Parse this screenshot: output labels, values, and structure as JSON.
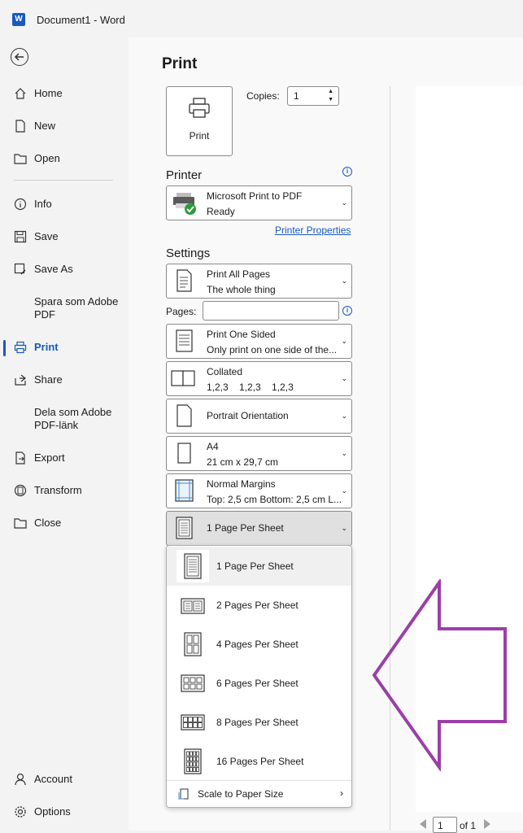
{
  "titlebar": {
    "title": "Document1  -  Word",
    "app_icon": "W"
  },
  "sidebar": {
    "items": [
      {
        "label": "Home",
        "icon": "home-icon"
      },
      {
        "label": "New",
        "icon": "new-doc-icon"
      },
      {
        "label": "Open",
        "icon": "folder-icon"
      },
      {
        "label": "Info",
        "icon": "info-icon"
      },
      {
        "label": "Save",
        "icon": "save-icon"
      },
      {
        "label": "Save As",
        "icon": "save-as-icon"
      },
      {
        "label": "Spara som Adobe PDF",
        "icon": ""
      },
      {
        "label": "Print",
        "icon": "printer-icon"
      },
      {
        "label": "Share",
        "icon": "share-icon"
      },
      {
        "label": "Dela som Adobe PDF-länk",
        "icon": ""
      },
      {
        "label": "Export",
        "icon": "export-icon"
      },
      {
        "label": "Transform",
        "icon": "transform-icon"
      },
      {
        "label": "Close",
        "icon": "close-folder-icon"
      },
      {
        "label": "Account",
        "icon": "account-icon"
      },
      {
        "label": "Options",
        "icon": "options-gear-icon"
      }
    ],
    "active": "Print"
  },
  "print": {
    "heading": "Print",
    "print_button": "Print",
    "copies_label": "Copies:",
    "copies_value": "1",
    "printer_heading": "Printer",
    "printer_name": "Microsoft Print to PDF",
    "printer_status": "Ready",
    "printer_properties": "Printer Properties",
    "settings_heading": "Settings",
    "pages_label": "Pages:",
    "pages_value": "",
    "settings": [
      {
        "line1": "Print All Pages",
        "line2": "The whole thing"
      },
      {
        "line1": "Print One Sided",
        "line2": "Only print on one side of the..."
      },
      {
        "line1": "Collated",
        "line2": "1,2,3    1,2,3    1,2,3"
      },
      {
        "line1": "Portrait Orientation",
        "line2": ""
      },
      {
        "line1": "A4",
        "line2": "21 cm x 29,7 cm"
      },
      {
        "line1": "Normal Margins",
        "line2": "Top: 2,5 cm Bottom: 2,5 cm L..."
      },
      {
        "line1": "1 Page Per Sheet",
        "line2": ""
      }
    ],
    "pages_per_sheet_menu": [
      "1 Page Per Sheet",
      "2 Pages Per Sheet",
      "4 Pages Per Sheet",
      "6 Pages Per Sheet",
      "8 Pages Per Sheet",
      "16 Pages Per Sheet"
    ],
    "selected_option": "1 Page Per Sheet",
    "scale_label": "Scale to Paper Size"
  },
  "pager": {
    "current": "1",
    "of_text": "of 1"
  },
  "annotation": {
    "arrow_color": "#9b3fa8",
    "icon": "left-pointing-arrow-outline"
  },
  "colors": {
    "accent": "#185abd",
    "arrow": "#9b3fa8"
  }
}
